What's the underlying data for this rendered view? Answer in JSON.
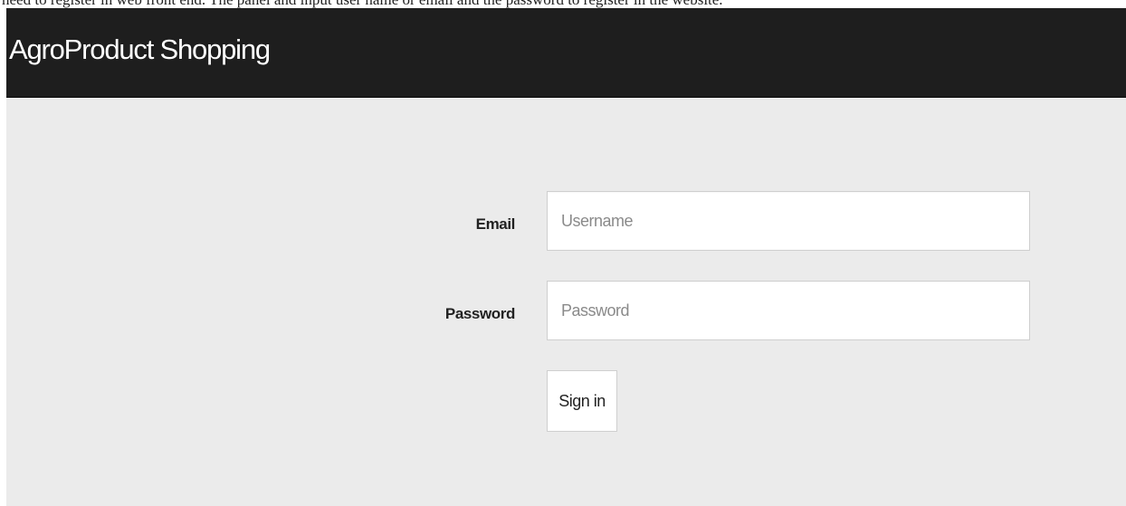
{
  "caption": "need to register in web front end. The panel and input user name or email and the password to register in the website.",
  "navbar": {
    "brand": "AgroProduct Shopping"
  },
  "login_form": {
    "email_label": "Email",
    "email_placeholder": "Username",
    "email_value": "",
    "password_label": "Password",
    "password_placeholder": "Password",
    "password_value": "",
    "submit_label": "Sign in"
  },
  "colors": {
    "navbar_background": "#1e1e1e",
    "page_background": "#ebebeb",
    "input_background": "#ffffff",
    "input_border": "#cfcfcf"
  }
}
